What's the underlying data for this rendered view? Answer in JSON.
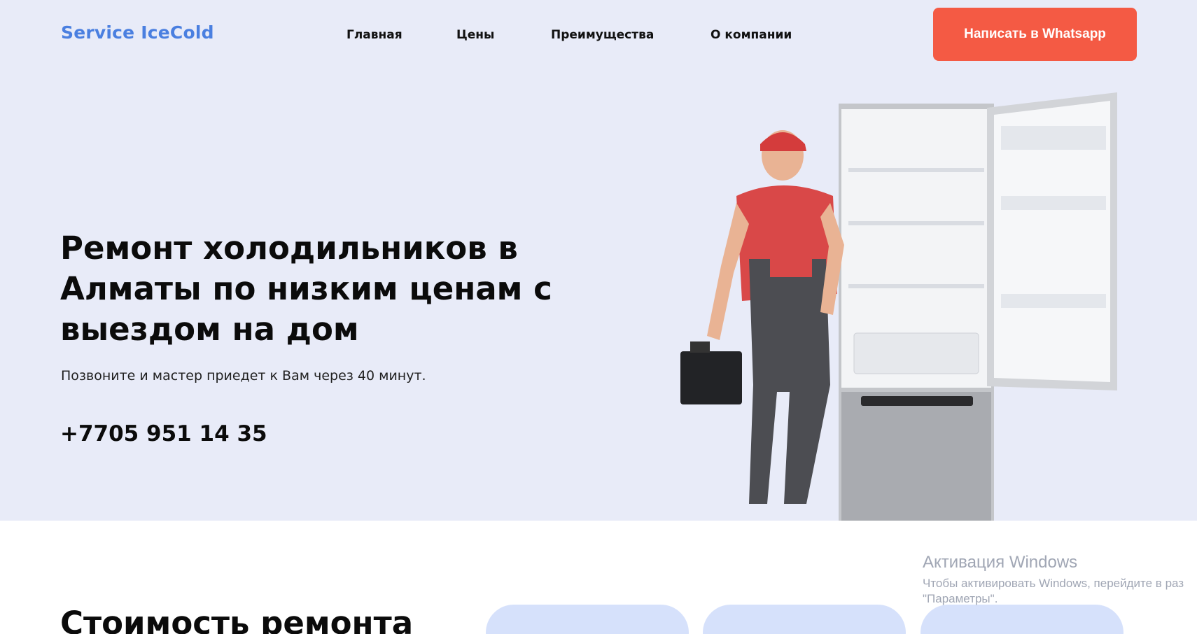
{
  "header": {
    "logo": "Service IceCold",
    "nav": [
      {
        "label": "Главная"
      },
      {
        "label": "Цены"
      },
      {
        "label": "Преимущества"
      },
      {
        "label": "О компании"
      }
    ],
    "cta_label": "Написать в Whatsapp"
  },
  "hero": {
    "title": "Ремонт холодильников в Алматы по низким ценам с выездом на дом",
    "subtitle": "Позвоните и мастер приедет к Вам через 40 минут.",
    "phone": "+7705 951 14 35"
  },
  "pricing": {
    "title": "Стоимость ремонта"
  },
  "watermark": {
    "title": "Активация Windows",
    "line1": "Чтобы активировать Windows, перейдите в раз",
    "line2": "\"Параметры\"."
  },
  "colors": {
    "hero_bg": "#e8ebf8",
    "logo": "#4a7fe0",
    "cta": "#f45a44",
    "card": "#d6e1fb"
  }
}
